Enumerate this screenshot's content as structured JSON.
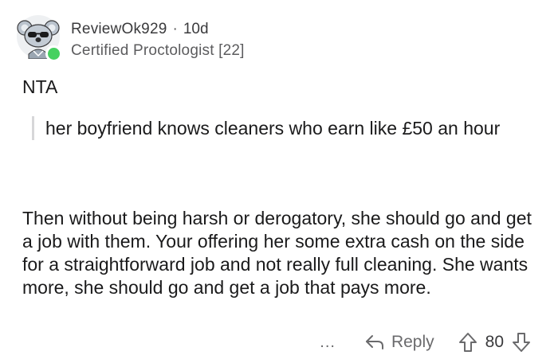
{
  "comment": {
    "author": "ReviewOk929",
    "separator": "·",
    "age": "10d",
    "flair": "Certified Proctologist [22]",
    "paragraphs": {
      "first": "NTA",
      "quote": "her boyfriend knows cleaners who earn like £50 an hour",
      "second": "Then without being harsh or derogatory, she should go and get a job with them. Your offering her some extra cash on the side for a straightforward job and not really full cleaning. She wants more, she should go and get a job that pays more."
    }
  },
  "actions": {
    "more_label": "...",
    "reply_label": "Reply",
    "vote_count": "80"
  },
  "icons": {
    "avatar": "koala-snoo-avatar-icon",
    "online": "online-status-icon",
    "reply": "reply-arrow-icon",
    "upvote": "upvote-arrow-icon",
    "downvote": "downvote-arrow-icon",
    "more": "more-options-icon"
  },
  "colors": {
    "online_green": "#46d160",
    "text": "#1a1a1b",
    "meta": "#5c5c5e",
    "quote_bar": "#d7d7d9"
  }
}
